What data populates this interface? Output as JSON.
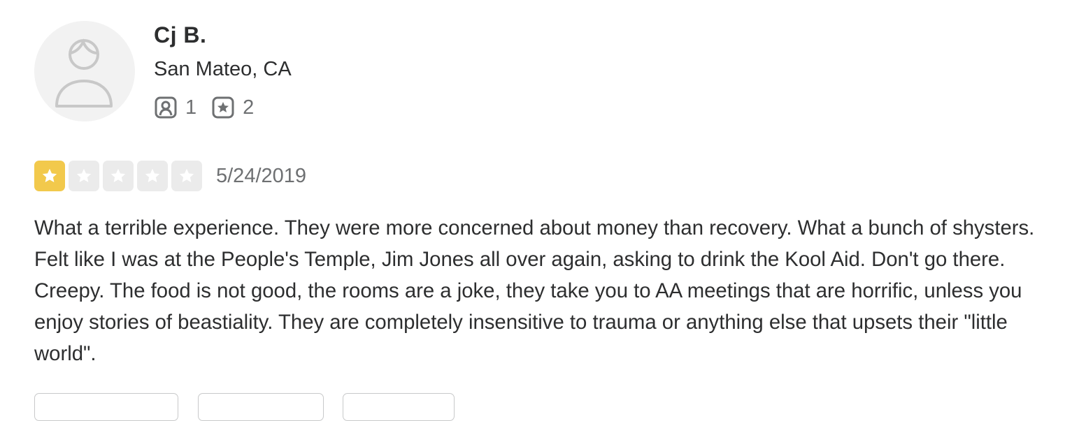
{
  "user": {
    "name": "Cj B.",
    "location": "San Mateo, CA",
    "friends_count": "1",
    "reviews_count": "2",
    "avatar_icon": "default-user-avatar-icon",
    "friends_icon": "friends-icon",
    "reviews_icon": "reviews-star-icon"
  },
  "review": {
    "rating": 1,
    "rating_max": 5,
    "date": "5/24/2019",
    "text": "What a terrible experience. They were more concerned about money than recovery. What a bunch of shysters. Felt like I was at the People's Temple, Jim Jones all over again, asking to drink the Kool Aid. Don't go there. Creepy. The food is not good, the rooms are a joke, they take you to AA meetings that are horrific, unless you enjoy stories of beastiality. They are completely insensitive to trauma or anything else that upsets their \"little world\"."
  },
  "colors": {
    "star_filled": "#f2c94c",
    "star_empty": "#ebebeb",
    "text_primary": "#2d2e2f",
    "text_secondary": "#6e7072"
  }
}
